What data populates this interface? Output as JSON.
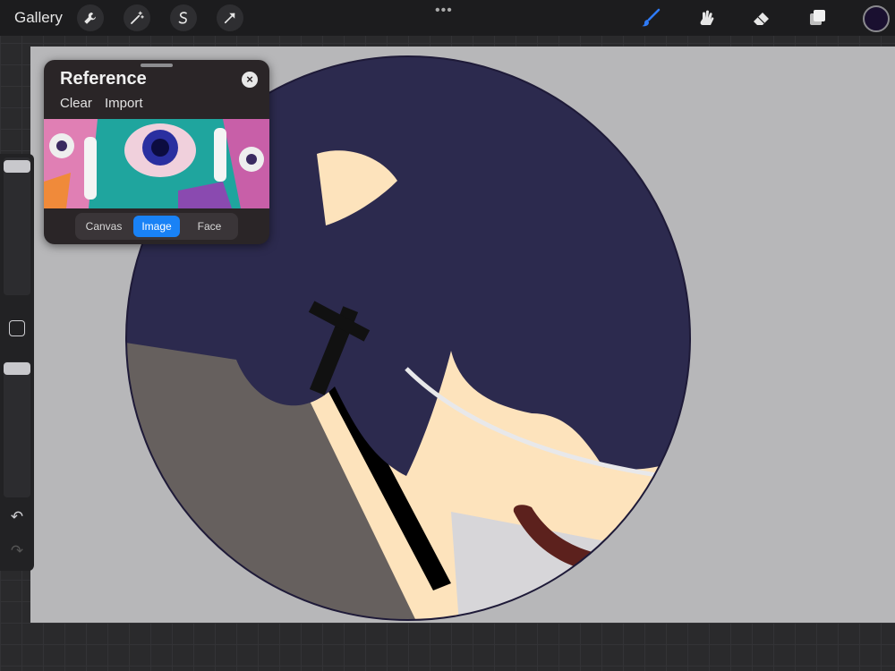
{
  "topbar": {
    "gallery_label": "Gallery",
    "more_label": "•••",
    "left_tools": [
      "wrench-icon",
      "magic-wand-icon",
      "selection-icon",
      "transform-arrow-icon"
    ],
    "right_tools": [
      "brush-icon",
      "smudge-icon",
      "eraser-icon",
      "layers-icon"
    ],
    "active_tool_color": "#2f7bf6",
    "current_color": "#1a1030"
  },
  "reference_panel": {
    "title": "Reference",
    "close_symbol": "×",
    "actions": {
      "clear": "Clear",
      "import": "Import"
    },
    "tabs": [
      "Canvas",
      "Image",
      "Face"
    ],
    "active_tab": "Image"
  },
  "sidebar": {
    "undo_symbol": "↶",
    "redo_symbol": "↷"
  },
  "palette": {
    "hair": "#2c2a4e",
    "skin": "#fde3bc",
    "shadow": "#66605e",
    "accent": "#1982f6"
  }
}
